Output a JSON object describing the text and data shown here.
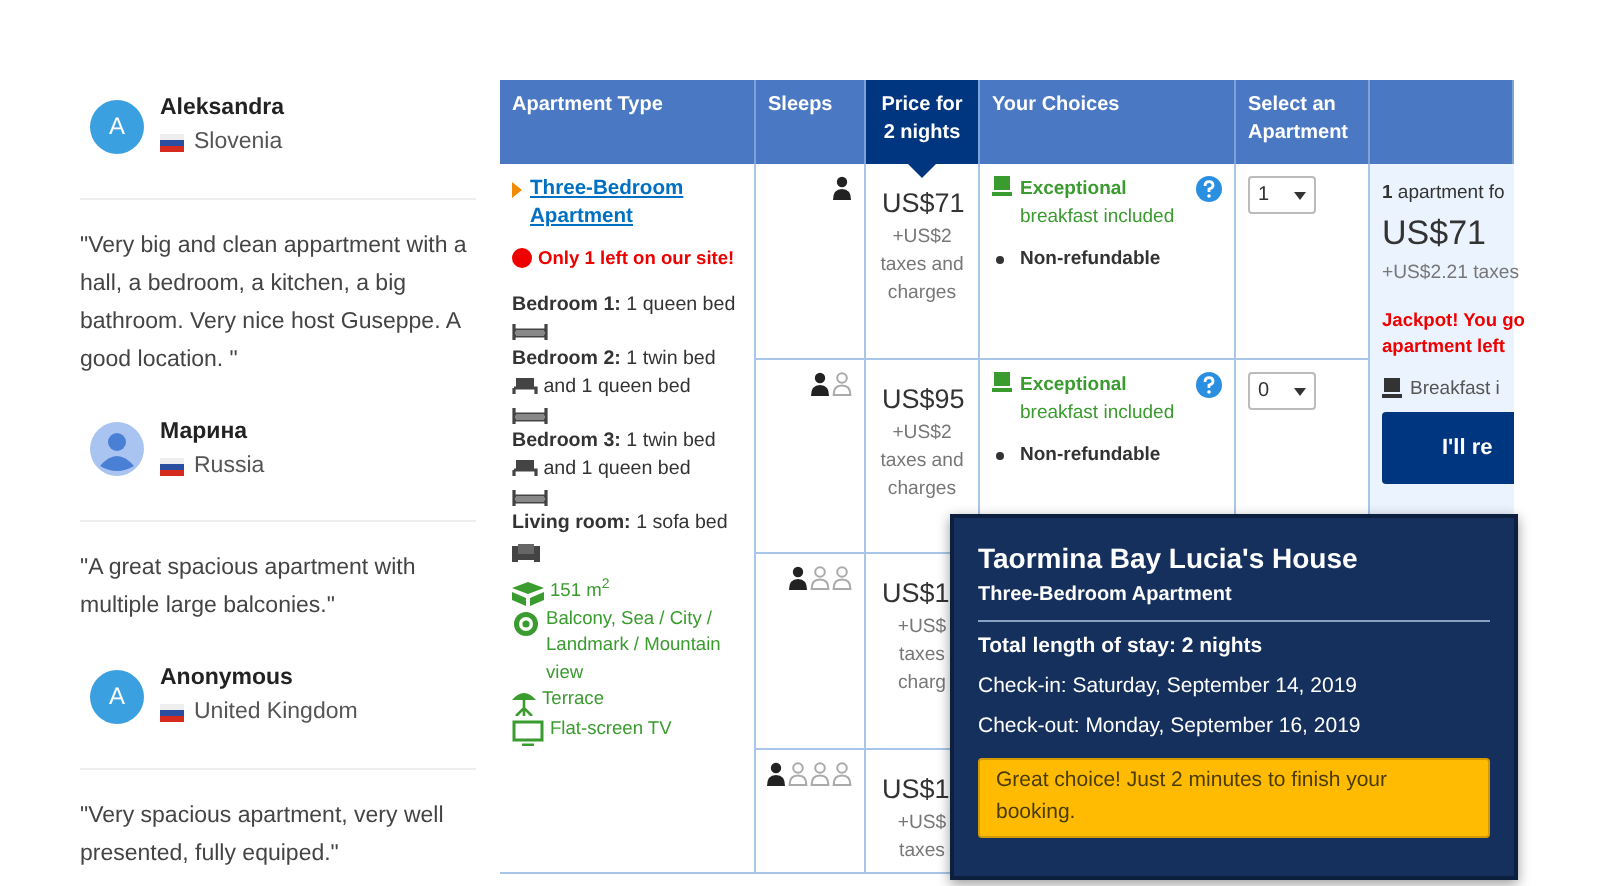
{
  "reviews": [
    {
      "kind": "reviewer",
      "initial": "A",
      "name": "Aleksandra",
      "country": "Slovenia"
    },
    {
      "kind": "quote",
      "text": "\"Very big and clean appartment with a hall, a bedroom, a kitchen, a big bathroom. Very nice host Guseppe. A good location. \""
    },
    {
      "kind": "reviewer",
      "name": "Марина",
      "country": "Russia"
    },
    {
      "kind": "quote",
      "text": "\"A great spacious apartment with multiple large balconies.\""
    },
    {
      "kind": "reviewer",
      "initial": "A",
      "name": "Anonymous",
      "country": "United Kingdom"
    },
    {
      "kind": "quote",
      "text": "\"Very spacious apartment, very well presented, fully equiped.\""
    }
  ],
  "table": {
    "columns": [
      {
        "label": "Apartment Type",
        "highlighted": false
      },
      {
        "label": "Sleeps",
        "highlighted": false
      },
      {
        "label": "Price for 2 nights",
        "highlighted": true
      },
      {
        "label": "Your Choices",
        "highlighted": false
      },
      {
        "label": "Select an Apartment",
        "highlighted": false
      }
    ],
    "apartment": {
      "title": "Three-Bedroom Apartment",
      "alert": "Only 1 left on our site!",
      "rooms": [
        {
          "room": "Bedroom 1:",
          "beds": [
            {
              "kind": "queen",
              "text": "1 queen bed"
            }
          ]
        },
        {
          "room": "Bedroom 2:",
          "beds": [
            {
              "kind": "twin",
              "text": "1 twin bed"
            },
            {
              "kind": "queen",
              "text": "and 1 queen bed"
            }
          ]
        },
        {
          "room": "Bedroom 3:",
          "beds": [
            {
              "kind": "twin",
              "text": "1 twin bed"
            },
            {
              "kind": "queen",
              "text": "and 1 queen bed"
            }
          ]
        },
        {
          "room": "Living room:",
          "beds": [
            {
              "kind": "sofa",
              "text": "1 sofa bed"
            }
          ]
        }
      ],
      "facilities": [
        {
          "kind": "area",
          "text": "151 m$^{2}$"
        },
        {
          "kind": "view",
          "text": "Balcony, Sea / City / Landmark / Mountain view"
        },
        {
          "kind": "terrace",
          "text": "Terrace"
        },
        {
          "kind": "tv",
          "text": "Flat-screen TV"
        }
      ]
    },
    "rows": [
      {
        "sleeps": [
          {
            "filled": true
          }
        ],
        "price": "US$71",
        "tax_lines": [
          "+US$2",
          "taxes and",
          "charges"
        ],
        "choices": [
          {
            "kind": "breakfast",
            "text": "**Exceptional** breakfast included"
          },
          {
            "kind": "bullet",
            "text": "Non-refundable"
          }
        ],
        "select": "1"
      },
      {
        "sleeps": [
          {
            "filled": true
          },
          {
            "filled": false
          }
        ],
        "price": "US$95",
        "tax_lines": [
          "+US$2",
          "taxes and",
          "charges"
        ],
        "choices": [
          {
            "kind": "breakfast",
            "text": "**Exceptional** breakfast included"
          },
          {
            "kind": "bullet",
            "text": "Non-refundable"
          }
        ],
        "select": "0"
      },
      {
        "sleeps": [
          {
            "filled": true
          },
          {
            "filled": false
          },
          {
            "filled": false
          }
        ],
        "price": "US$1",
        "tax_lines": [
          "+US$",
          "taxes",
          "charg"
        ]
      },
      {
        "sleeps": [
          {
            "filled": true
          },
          {
            "filled": false
          },
          {
            "filled": false
          },
          {
            "filled": false
          }
        ],
        "price": "US$1",
        "tax_lines": [
          "+US$",
          "taxes"
        ]
      }
    ],
    "summary": {
      "count": "**1** apartment fo",
      "price": "US$71",
      "taxes": "+US$2.21 taxes",
      "jackpot": [
        "Jackpot! You go",
        "apartment left"
      ],
      "breakfast": "Breakfast i",
      "button": "I'll re"
    }
  },
  "tooltip": {
    "title": "Taormina Bay Lucia's House",
    "subtitle": "Three-Bedroom Apartment",
    "total": "Total length of stay: 2 nights",
    "check_in": "Check-in: Saturday, September 14, 2019",
    "check_out": "Check-out: Monday, September 16, 2019",
    "notice": "Great choice! Just 2 minutes to finish your booking."
  }
}
